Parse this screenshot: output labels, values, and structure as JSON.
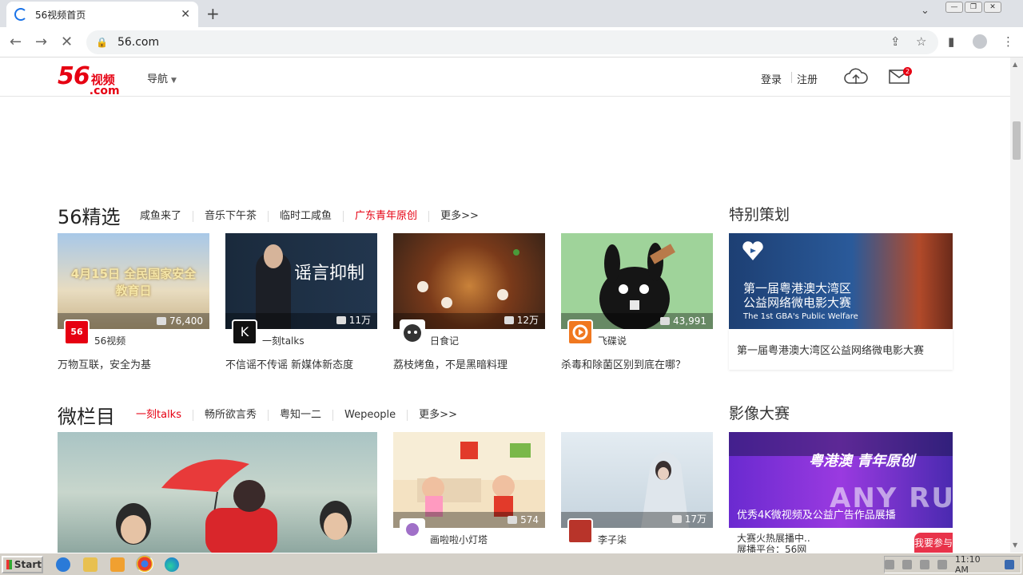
{
  "browser": {
    "tab_title": "56视频首页",
    "url": "56.com"
  },
  "header": {
    "logo_num": "56",
    "logo_cn": "视频",
    "logo_com": ".com",
    "nav_label": "导航",
    "login": "登录",
    "register": "注册",
    "mail_badge": "2"
  },
  "sec1": {
    "title": "56精选",
    "nav": [
      "咸鱼来了",
      "音乐下午茶",
      "临时工咸鱼",
      "广东青年原创",
      "更多>>"
    ],
    "side_title": "特别策划",
    "cards": [
      {
        "count": "76,400",
        "author": "56视频",
        "caption": "万物互联，安全为基",
        "thumb_text": "4月15日 全民国家安全教育日"
      },
      {
        "count": "11万",
        "author": "一刻talks",
        "caption": "不信谣不传谣 新媒体新态度",
        "thumb_text": "谣言抑制"
      },
      {
        "count": "12万",
        "author": "日食记",
        "caption": "荔枝烤鱼，不是黑暗料理",
        "thumb_text": ""
      },
      {
        "count": "43,991",
        "author": "飞碟说",
        "caption": "杀毒和除菌区别到底在哪？",
        "thumb_text": ""
      }
    ],
    "promo": {
      "caption": "第一届粤港澳大湾区公益网络微电影大赛",
      "img_line1": "第一届粤港澳大湾区",
      "img_line2": "公益网络微电影大赛",
      "img_line3": "The 1st GBA's Public Welfare"
    }
  },
  "sec2": {
    "title": "微栏目",
    "nav": [
      "一刻talks",
      "畅所欲言秀",
      "粤知一二",
      "Wepeople",
      "更多>>"
    ],
    "side_title": "影像大赛",
    "cards": [
      {
        "count": "574",
        "author": "画啦啦小灯塔"
      },
      {
        "count": "17万",
        "author": "李子柒"
      }
    ],
    "promo": {
      "overlay": "优秀4K微视频及公益广告作品展播",
      "caption": "大赛火热展播中..",
      "caption2": "展播平台：56网",
      "img_text": "粤港澳 青年原创",
      "btn": "我要参与"
    }
  },
  "taskbar": {
    "start": "Start",
    "clock": "11:10 AM"
  },
  "watermark": "ANY RUN",
  "colors": {
    "brand_red": "#e60012"
  }
}
